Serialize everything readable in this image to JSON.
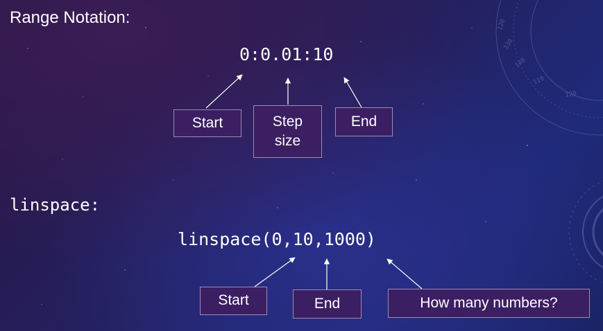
{
  "range_section": {
    "heading": "Range Notation:",
    "code": "0:0.01:10",
    "labels": {
      "start": "Start",
      "step": "Step\nsize",
      "end": "End"
    }
  },
  "linspace_section": {
    "heading": "linspace:",
    "code": "linspace(0,10,1000)",
    "labels": {
      "start": "Start",
      "end": "End",
      "count": "How many numbers?"
    }
  },
  "colors": {
    "box_fill": "#3b1f62",
    "box_border": "#9c8ab8",
    "text": "#ffffff"
  },
  "decoration": {
    "dial_numerals": [
      "120",
      "130",
      "140",
      "110",
      "120"
    ]
  }
}
